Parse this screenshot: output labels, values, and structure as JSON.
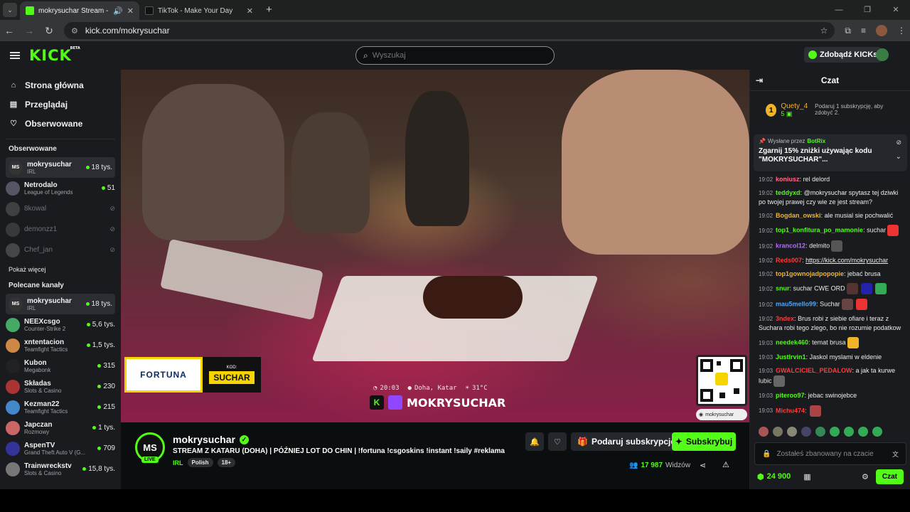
{
  "browser": {
    "tabs": [
      {
        "title": "mokrysuchar Stream - Watch",
        "active": true
      },
      {
        "title": "TikTok - Make Your Day",
        "active": false
      }
    ],
    "url": "kick.com/mokrysuchar"
  },
  "header": {
    "logo": "KICK",
    "logo_badge": "BETA",
    "search_placeholder": "Wyszukaj",
    "kicks_button": "Zdobądź KICKs"
  },
  "sidebar": {
    "nav": [
      {
        "label": "Strona główna",
        "icon": "home-icon"
      },
      {
        "label": "Przeglądaj",
        "icon": "browse-icon"
      },
      {
        "label": "Obserwowane",
        "icon": "heart-icon"
      }
    ],
    "followed_title": "Obserwowane",
    "followed": [
      {
        "name": "mokrysuchar",
        "sub": "IRL",
        "viewers": "18 tys.",
        "live": true,
        "selected": true,
        "color": "#333"
      },
      {
        "name": "Netrodalo",
        "sub": "League of Legends",
        "viewers": "51",
        "live": true,
        "color": "#556"
      },
      {
        "name": "8kowal",
        "sub": "",
        "viewers": "",
        "live": false,
        "color": "#777"
      },
      {
        "name": "demonzz1",
        "sub": "",
        "viewers": "",
        "live": false,
        "color": "#666"
      },
      {
        "name": "Chef_jan",
        "sub": "",
        "viewers": "",
        "live": false,
        "color": "#888"
      }
    ],
    "show_more": "Pokaż więcej",
    "recommended_title": "Polecane kanały",
    "recommended": [
      {
        "name": "mokrysuchar",
        "sub": "IRL",
        "viewers": "18 tys.",
        "color": "#333",
        "selected": true
      },
      {
        "name": "NEEXcsgo",
        "sub": "Counter-Strike 2",
        "viewers": "5,6 tys.",
        "color": "#4a6"
      },
      {
        "name": "xntentacion",
        "sub": "Teamfight Tactics",
        "viewers": "1,5 tys.",
        "color": "#c84"
      },
      {
        "name": "Kubon",
        "sub": "Megabonk",
        "viewers": "315",
        "color": "#222"
      },
      {
        "name": "Składas",
        "sub": "Slots & Casino",
        "viewers": "230",
        "color": "#a33"
      },
      {
        "name": "Kezman22",
        "sub": "Teamfight Tactics",
        "viewers": "215",
        "color": "#48c"
      },
      {
        "name": "Japczan",
        "sub": "Rozmowy",
        "viewers": "1 tys.",
        "color": "#c66"
      },
      {
        "name": "AspenTV",
        "sub": "Grand Theft Auto V (G...",
        "viewers": "709",
        "color": "#339"
      },
      {
        "name": "Trainwreckstv",
        "sub": "Slots & Casino",
        "viewers": "15,8 tys.",
        "color": "#777"
      }
    ]
  },
  "video": {
    "fortuna_brand": "FORTUNA",
    "code_label": "KOD:",
    "code_value": "SUCHAR",
    "overlay_time": "20:03",
    "overlay_location": "Doha, Katar",
    "overlay_temp": "31°C",
    "overlay_name": "MOKRYSUCHAR",
    "qr_label": "mokrysuchar"
  },
  "stream": {
    "avatar_initials": "MS",
    "live_badge": "LIVE",
    "name": "mokrysuchar",
    "title": "STREAM Z KATARU (DOHA) | PÓŹNIEJ LOT DO CHIN | !fortuna !csgoskins !instant !saily #reklama",
    "category": "IRL",
    "tags": [
      "Polish",
      "18+"
    ],
    "gift_button": "Podaruj subskrypcje",
    "subscribe_button": "Subskrybuj",
    "viewers_count": "17 987",
    "viewers_label": "Widzów"
  },
  "chat": {
    "title": "Czat",
    "top_gifter": {
      "rank": "1",
      "name": "Quety_4",
      "count": "5",
      "desc": "Podaruj 1 subskrypcję, aby zdobyć 2."
    },
    "pinned": {
      "sent_by": "Wysłane przez",
      "bot": "BotRix",
      "message": "Zgarnij 15% zniżki używając kodu \"MOKRYSUCHAR\"..."
    },
    "messages": [
      {
        "time": "19:02",
        "user": "koniusz",
        "color": "#ff6b8b",
        "text": "rel delord"
      },
      {
        "time": "19:02",
        "user": "teddyxd",
        "color": "#53fc18",
        "text": "@mokrysuchar spytasz tej dziwki po twojej prawej czy wie ze jest stream?"
      },
      {
        "time": "19:02",
        "user": "Bogdan_owski",
        "color": "#f0b429",
        "text": "ale musial sie pochwalić"
      },
      {
        "time": "19:02",
        "user": "top1_konfitura_po_mamonie",
        "color": "#53fc18",
        "text": "suchar"
      },
      {
        "time": "19:02",
        "user": "krancol12",
        "color": "#b06cff",
        "text": "delmito"
      },
      {
        "time": "19:02",
        "user": "Reds007",
        "color": "#ff3b3b",
        "text": "https://kick.com/mokrysuchar"
      },
      {
        "time": "19:02",
        "user": "top1gownojadpopopie",
        "color": "#f0b429",
        "text": "jebać brusa"
      },
      {
        "time": "19:02",
        "user": "snur",
        "color": "#53fc18",
        "text": "suchar CWE ORD"
      },
      {
        "time": "19:02",
        "user": "mau5mello99",
        "color": "#4aa8ff",
        "text": "Suchar"
      },
      {
        "time": "19:02",
        "user": "3ndex",
        "color": "#ff3b3b",
        "text": "Brus robi z siebie ofiare i teraz z Suchara robi tego zlego, bo nie rozumie podatkow"
      },
      {
        "time": "19:03",
        "user": "needek460",
        "color": "#53fc18",
        "text": "temat brusa"
      },
      {
        "time": "19:03",
        "user": "Justlrvin1",
        "color": "#53fc18",
        "text": "Jaskol myslami w eldenie"
      },
      {
        "time": "19:03",
        "user": "GWALCICIEL_PEDALOW",
        "color": "#ff3b3b",
        "text": "a jak ta kurwe lubic"
      },
      {
        "time": "19:03",
        "user": "piteroo97",
        "color": "#53fc18",
        "text": "jebac swinojebce"
      },
      {
        "time": "19:03",
        "user": "Michu474",
        "color": "#ff3b3b",
        "text": ""
      }
    ],
    "input_placeholder": "Zostałeś zbanowany na czacie",
    "points": "24 900",
    "chat_button": "Czat"
  }
}
